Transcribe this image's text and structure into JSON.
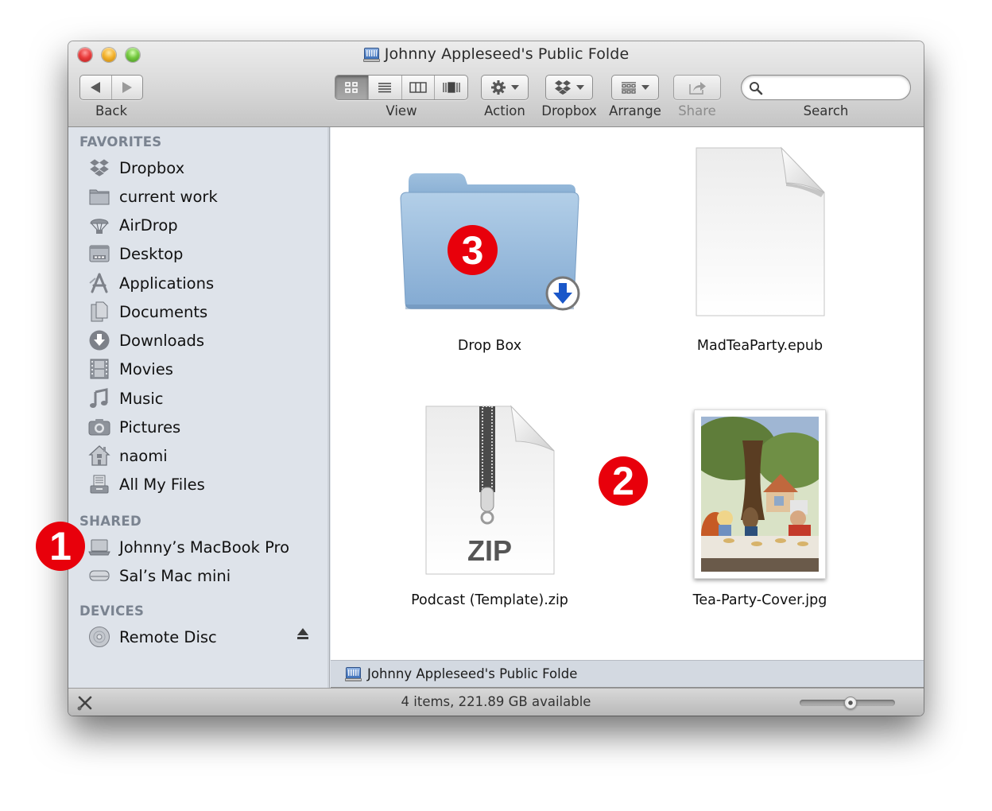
{
  "window": {
    "title": "Johnny Appleseed's Public Folde",
    "title_icon": "shared-volume-icon"
  },
  "toolbar": {
    "back_label": "Back",
    "view_label": "View",
    "view_modes": [
      "icon",
      "list",
      "column",
      "cover-flow"
    ],
    "view_mode_selected": "icon",
    "action_label": "Action",
    "dropbox_label": "Dropbox",
    "arrange_label": "Arrange",
    "share_label": "Share",
    "share_enabled": false,
    "search_label": "Search",
    "search_value": "",
    "search_placeholder": ""
  },
  "sidebar": {
    "sections": [
      {
        "header": "FAVORITES",
        "items": [
          {
            "label": "Dropbox",
            "icon": "dropbox-icon"
          },
          {
            "label": "current work",
            "icon": "folder-icon"
          },
          {
            "label": "AirDrop",
            "icon": "airdrop-icon"
          },
          {
            "label": "Desktop",
            "icon": "desktop-icon"
          },
          {
            "label": "Applications",
            "icon": "applications-icon"
          },
          {
            "label": "Documents",
            "icon": "documents-icon"
          },
          {
            "label": "Downloads",
            "icon": "downloads-icon"
          },
          {
            "label": "Movies",
            "icon": "movies-icon"
          },
          {
            "label": "Music",
            "icon": "music-icon"
          },
          {
            "label": "Pictures",
            "icon": "pictures-icon"
          },
          {
            "label": "naomi",
            "icon": "home-icon"
          },
          {
            "label": "All My Files",
            "icon": "all-my-files-icon"
          }
        ]
      },
      {
        "header": "SHARED",
        "items": [
          {
            "label": "Johnny’s MacBook Pro",
            "icon": "laptop-icon",
            "ejectable": true
          },
          {
            "label": "Sal’s Mac mini",
            "icon": "mac-mini-icon"
          }
        ]
      },
      {
        "header": "DEVICES",
        "items": [
          {
            "label": "Remote Disc",
            "icon": "disc-icon"
          }
        ]
      }
    ]
  },
  "files": [
    {
      "name": "Drop Box",
      "kind": "drop-box-folder"
    },
    {
      "name": "MadTeaParty.epub",
      "kind": "document"
    },
    {
      "name": "Podcast (Template).zip",
      "kind": "zip-archive"
    },
    {
      "name": "Tea-Party-Cover.jpg",
      "kind": "image-thumbnail"
    }
  ],
  "pathbar": {
    "label": "Johnny Appleseed's Public Folde"
  },
  "statusbar": {
    "text": "4 items, 221.89 GB available",
    "icon_size_slider_fraction": 0.53
  },
  "callouts": [
    "1",
    "2",
    "3"
  ],
  "colors": {
    "callout_red": "#e8000b",
    "sidebar_bg": "#dee3ea",
    "folder_blue": "#8fb5d9",
    "section_header": "#7a8390"
  }
}
